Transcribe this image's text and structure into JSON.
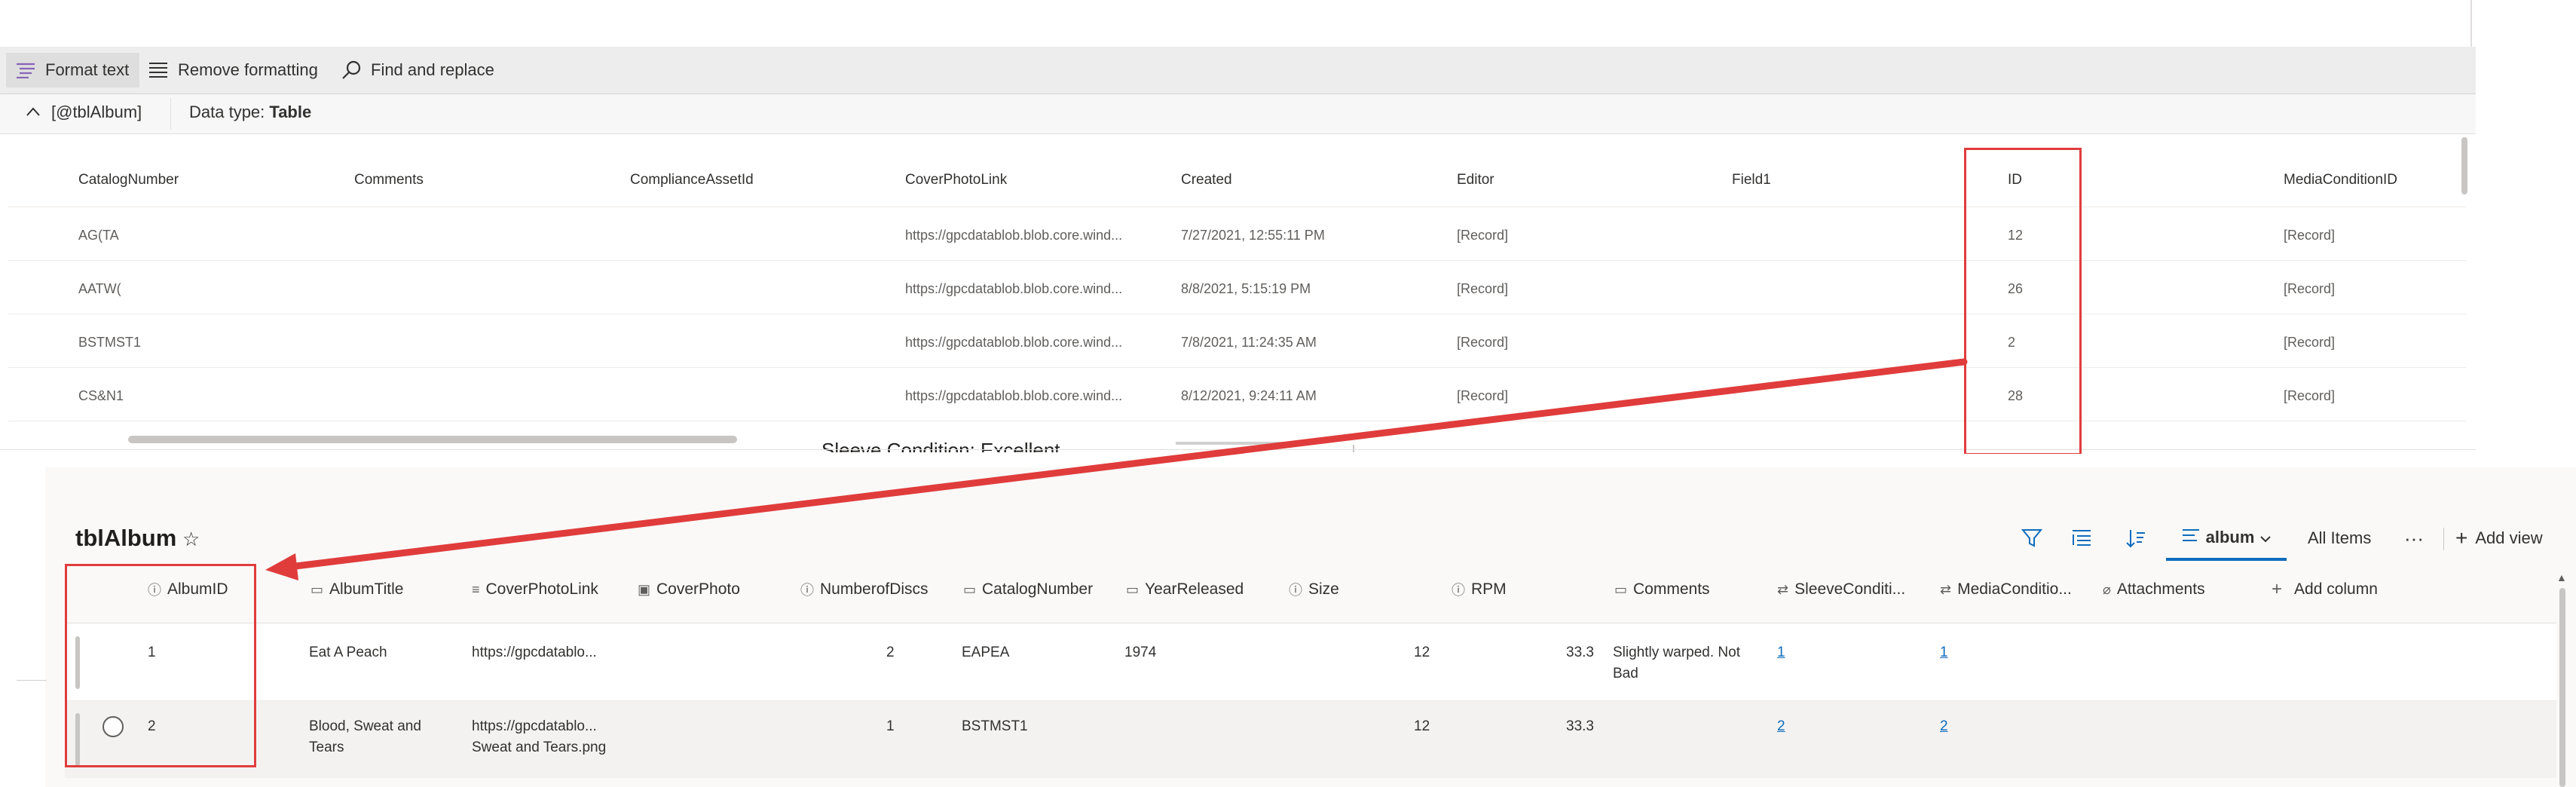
{
  "toolbar": {
    "format_text": "Format text",
    "remove_formatting": "Remove formatting",
    "find_replace": "Find and replace"
  },
  "expression": {
    "name": "[@tblAlbum]",
    "type_prefix": "Data type: ",
    "type_value": "Table"
  },
  "top_table": {
    "columns": [
      "CatalogNumber",
      "Comments",
      "ComplianceAssetId",
      "CoverPhotoLink",
      "Created",
      "Editor",
      "Field1",
      "ID",
      "MediaConditionID"
    ],
    "rows": [
      {
        "catalog": "AG(TA",
        "cover": "https://gpcdatablob.blob.core.wind...",
        "created": "7/27/2021, 12:55:11 PM",
        "editor": "[Record]",
        "id": "12",
        "media": "[Record]"
      },
      {
        "catalog": "AATW(",
        "cover": "https://gpcdatablob.blob.core.wind...",
        "created": "8/8/2021, 5:15:19 PM",
        "editor": "[Record]",
        "id": "26",
        "media": "[Record]"
      },
      {
        "catalog": "BSTMST1",
        "cover": "https://gpcdatablob.blob.core.wind...",
        "created": "7/8/2021, 11:24:35 AM",
        "editor": "[Record]",
        "id": "2",
        "media": "[Record]"
      },
      {
        "catalog": "CS&N1",
        "cover": "https://gpcdatablob.blob.core.wind...",
        "created": "8/12/2021, 9:24:11 AM",
        "editor": "[Record]",
        "id": "28",
        "media": "[Record]"
      }
    ]
  },
  "peek_text": "Sleeve Condition: Excellent",
  "list": {
    "title": "tblAlbum",
    "view_name": "album",
    "all_items": "All Items",
    "more": "···",
    "add_view": "Add view",
    "columns": [
      "AlbumID",
      "AlbumTitle",
      "CoverPhotoLink",
      "CoverPhoto",
      "NumberofDiscs",
      "CatalogNumber",
      "YearReleased",
      "Size",
      "RPM",
      "Comments",
      "SleeveConditi...",
      "MediaConditio...",
      "Attachments",
      "Add column"
    ],
    "rows": [
      {
        "album_id": "1",
        "title": "Eat A Peach",
        "cover_link": "https://gpcdatablo...",
        "cover_link2": "",
        "discs": "2",
        "catalog": "EAPEA",
        "year": "1974",
        "size": "12",
        "rpm": "33.3",
        "comments": "Slightly warped. Not",
        "comments2": "Bad",
        "sleeve": "1",
        "media": "1"
      },
      {
        "album_id": "2",
        "title": "Blood, Sweat and",
        "title2": "Tears",
        "cover_link": "https://gpcdatablo...",
        "cover_link2": "Sweat and Tears.png",
        "discs": "1",
        "catalog": "BSTMST1",
        "year": "",
        "size": "12",
        "rpm": "33.3",
        "comments": "",
        "comments2": "",
        "sleeve": "2",
        "media": "2"
      }
    ]
  },
  "colors": {
    "accent": "#0f6cbd",
    "highlight_red": "#e03c3c"
  }
}
